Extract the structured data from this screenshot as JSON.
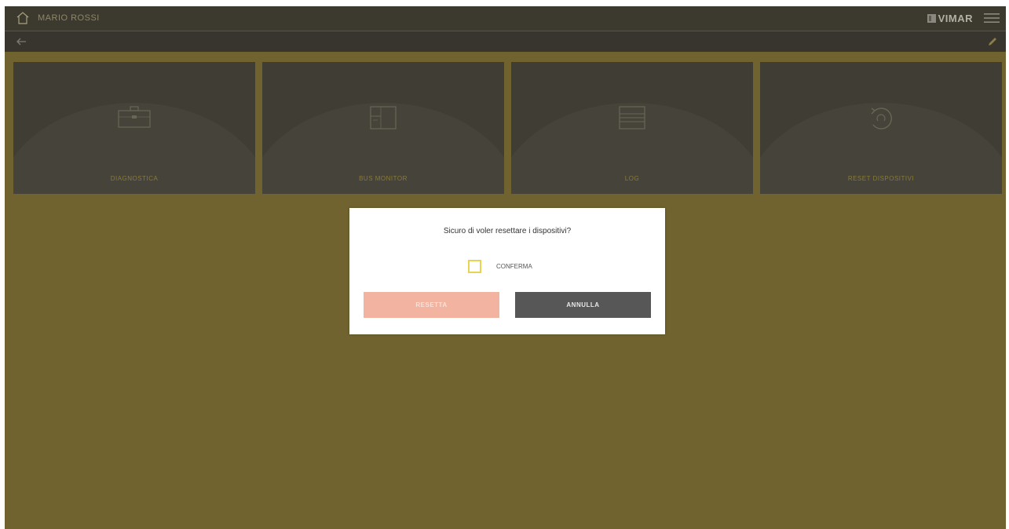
{
  "header": {
    "title": "MARIO ROSSI",
    "logo_text": "VIMAR",
    "home_icon": "home-icon",
    "menu_icon": "hamburger-menu-icon"
  },
  "subheader": {
    "back_icon": "back-arrow-icon",
    "edit_icon": "pencil-icon"
  },
  "tiles": [
    {
      "label": "DIAGNOSTICA",
      "icon": "briefcase-icon"
    },
    {
      "label": "BUS MONITOR",
      "icon": "monitor-window-icon"
    },
    {
      "label": "LOG",
      "icon": "log-list-icon"
    },
    {
      "label": "RESET DISPOSITIVI",
      "icon": "reset-refresh-icon"
    }
  ],
  "dialog": {
    "message": "Sicuro di voler resettare i dispositivi?",
    "checkbox_label": "CONFERMA",
    "reset_label": "RESETTA",
    "cancel_label": "ANNULLA"
  },
  "colors": {
    "background": "#70632f",
    "topbar": "#3c3a2e",
    "tile": "#3f3d34",
    "accent_yellow": "#e8d352",
    "reset_button": "#f2b3a0",
    "cancel_button": "#575757"
  }
}
